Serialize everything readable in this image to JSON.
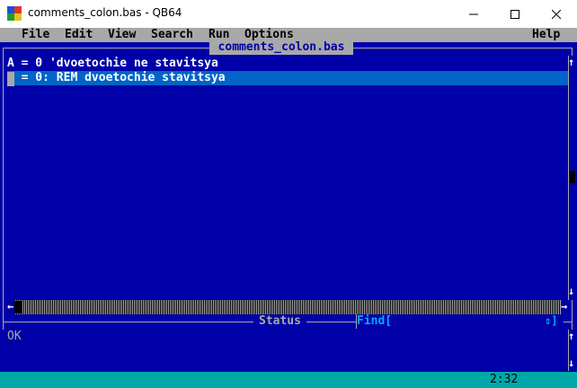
{
  "window": {
    "title": "comments_colon.bas - QB64",
    "minimize_glyph": "—",
    "maximize_glyph": "☐",
    "close_glyph": "✕"
  },
  "icon_colors": [
    "#1f4fd8",
    "#d83b1f",
    "#1fa02f",
    "#e8c21a"
  ],
  "menu": {
    "items": [
      "File",
      "Edit",
      "View",
      "Search",
      "Run",
      "Options"
    ],
    "help": "Help"
  },
  "editor": {
    "file_tab": "comments_colon.bas",
    "lines": [
      "A = 0 'dvoetochie ne stavitsya",
      "B = 0: REM dvoetochie stavitsya"
    ],
    "selected_line": 2
  },
  "status": {
    "label": "Status",
    "find_label": "Find[",
    "find_arrows": "⇕]",
    "message": "OK"
  },
  "scroll_arrows": {
    "up": "↑",
    "down": "↓",
    "left": "←",
    "right": "→"
  },
  "bottom": {
    "cursor_position": "2:32"
  },
  "colors": {
    "ide_background": "#0000a8",
    "menu_background": "#a8a8a8",
    "selection": "#0064c8",
    "bottom_bar": "#00a8a8"
  }
}
